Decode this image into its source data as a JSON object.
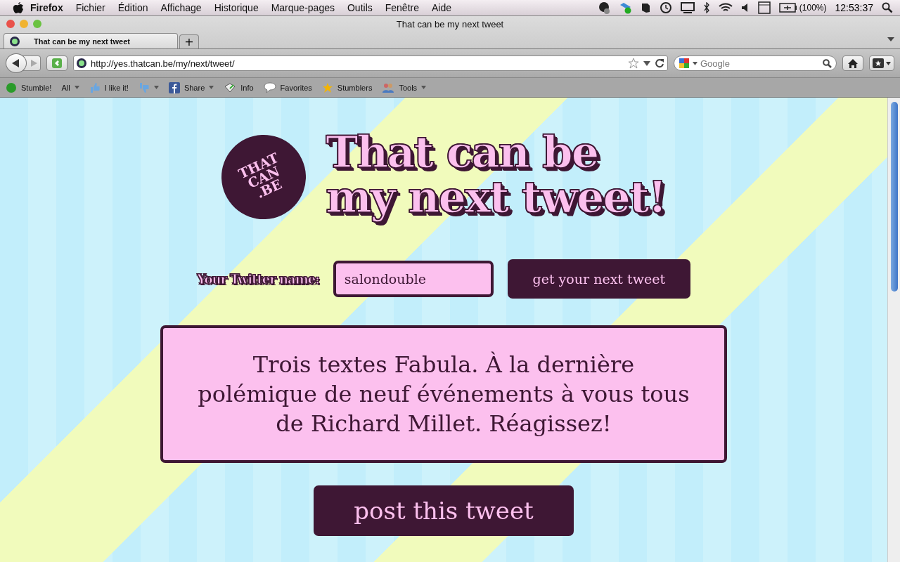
{
  "menubar": {
    "app": "Firefox",
    "menus": [
      "Fichier",
      "Édition",
      "Affichage",
      "Historique",
      "Marque-pages",
      "Outils",
      "Fenêtre",
      "Aide"
    ],
    "battery": "(100%)",
    "clock": "12:53:37"
  },
  "window": {
    "title": "That can be my next tweet"
  },
  "tabs": [
    {
      "label": "That can be my next tweet",
      "selected": true
    }
  ],
  "new_tab": "+",
  "address_bar": {
    "value": "http://yes.thatcan.be/my/next/tweet/"
  },
  "search": {
    "placeholder": "Google"
  },
  "bookmarks": [
    {
      "label": "Stumble!",
      "dropdown": false
    },
    {
      "label": "All",
      "dropdown": true
    },
    {
      "label": "I like it!",
      "dropdown": false
    },
    {
      "dropdown": true
    },
    {
      "label": "Share",
      "dropdown": true
    },
    {
      "label": "Info",
      "dropdown": false
    },
    {
      "label": "Favorites",
      "dropdown": false
    },
    {
      "label": "Stumblers",
      "dropdown": false
    },
    {
      "label": "Tools",
      "dropdown": true
    }
  ],
  "page": {
    "logo": [
      "THAT",
      "CAN",
      ".BE"
    ],
    "headline": [
      "That can be",
      "my next tweet!"
    ],
    "name_label": "Your Twitter name:",
    "name_field": {
      "value": "salondouble"
    },
    "get_button": "get your next tweet",
    "tweet": "Trois textes Fabula. À la dernière polémique de neuf événements à vous tous de Richard Millet. Réagissez!",
    "post_button": "post this tweet"
  }
}
